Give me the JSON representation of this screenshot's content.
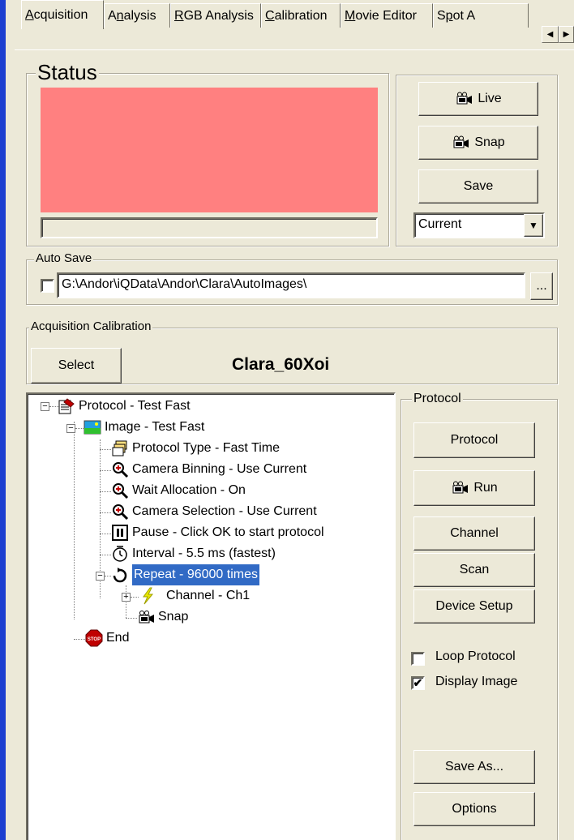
{
  "tabs": [
    {
      "label": "Acquisition",
      "accel": "A"
    },
    {
      "label": "Analysis",
      "accel": "n"
    },
    {
      "label": "RGB Analysis",
      "accel": "R"
    },
    {
      "label": "Calibration",
      "accel": "C"
    },
    {
      "label": "Movie Editor",
      "accel": "M"
    },
    {
      "label": "Spot A",
      "accel": "p"
    }
  ],
  "status": {
    "legend": "Status",
    "display_color": "#ff8080"
  },
  "actions": {
    "live": "Live",
    "snap": "Snap",
    "save": "Save",
    "save_target": "Current"
  },
  "autosave": {
    "legend": "Auto Save",
    "checked": false,
    "path": "G:\\Andor\\iQData\\Andor\\Clara\\AutoImages\\",
    "browse": "..."
  },
  "calibration": {
    "legend": "Acquisition Calibration",
    "select": "Select",
    "name": "Clara_60Xoi"
  },
  "tree": [
    {
      "label": "Protocol - Test Fast",
      "icon": "protocol-icon"
    },
    {
      "label": "Image - Test Fast",
      "icon": "image-icon"
    },
    {
      "label": "Protocol Type - Fast Time",
      "icon": "stack-icon"
    },
    {
      "label": "Camera Binning - Use Current",
      "icon": "magnifier-icon"
    },
    {
      "label": "Wait Allocation - On",
      "icon": "magnifier-icon"
    },
    {
      "label": "Camera Selection - Use Current",
      "icon": "magnifier-icon"
    },
    {
      "label": "Pause - Click OK to start protocol",
      "icon": "pause-icon"
    },
    {
      "label": "Interval - 5.5 ms (fastest)",
      "icon": "clock-icon"
    },
    {
      "label": "Repeat - 96000 times",
      "icon": "repeat-icon"
    },
    {
      "label": "Channel - Ch1",
      "icon": "lightning-icon"
    },
    {
      "label": "Snap",
      "icon": "camera-icon"
    },
    {
      "label": "End",
      "icon": "stop-icon"
    }
  ],
  "stop_sign_text": "STOP",
  "protocol": {
    "legend": "Protocol",
    "protocol_button": "Protocol",
    "run": "Run",
    "channel": "Channel",
    "scan": "Scan",
    "device_setup": "Device Setup",
    "loop_protocol": "Loop Protocol",
    "loop_checked": false,
    "display_image": "Display Image",
    "display_checked": true,
    "save_as": "Save As...",
    "options": "Options"
  }
}
